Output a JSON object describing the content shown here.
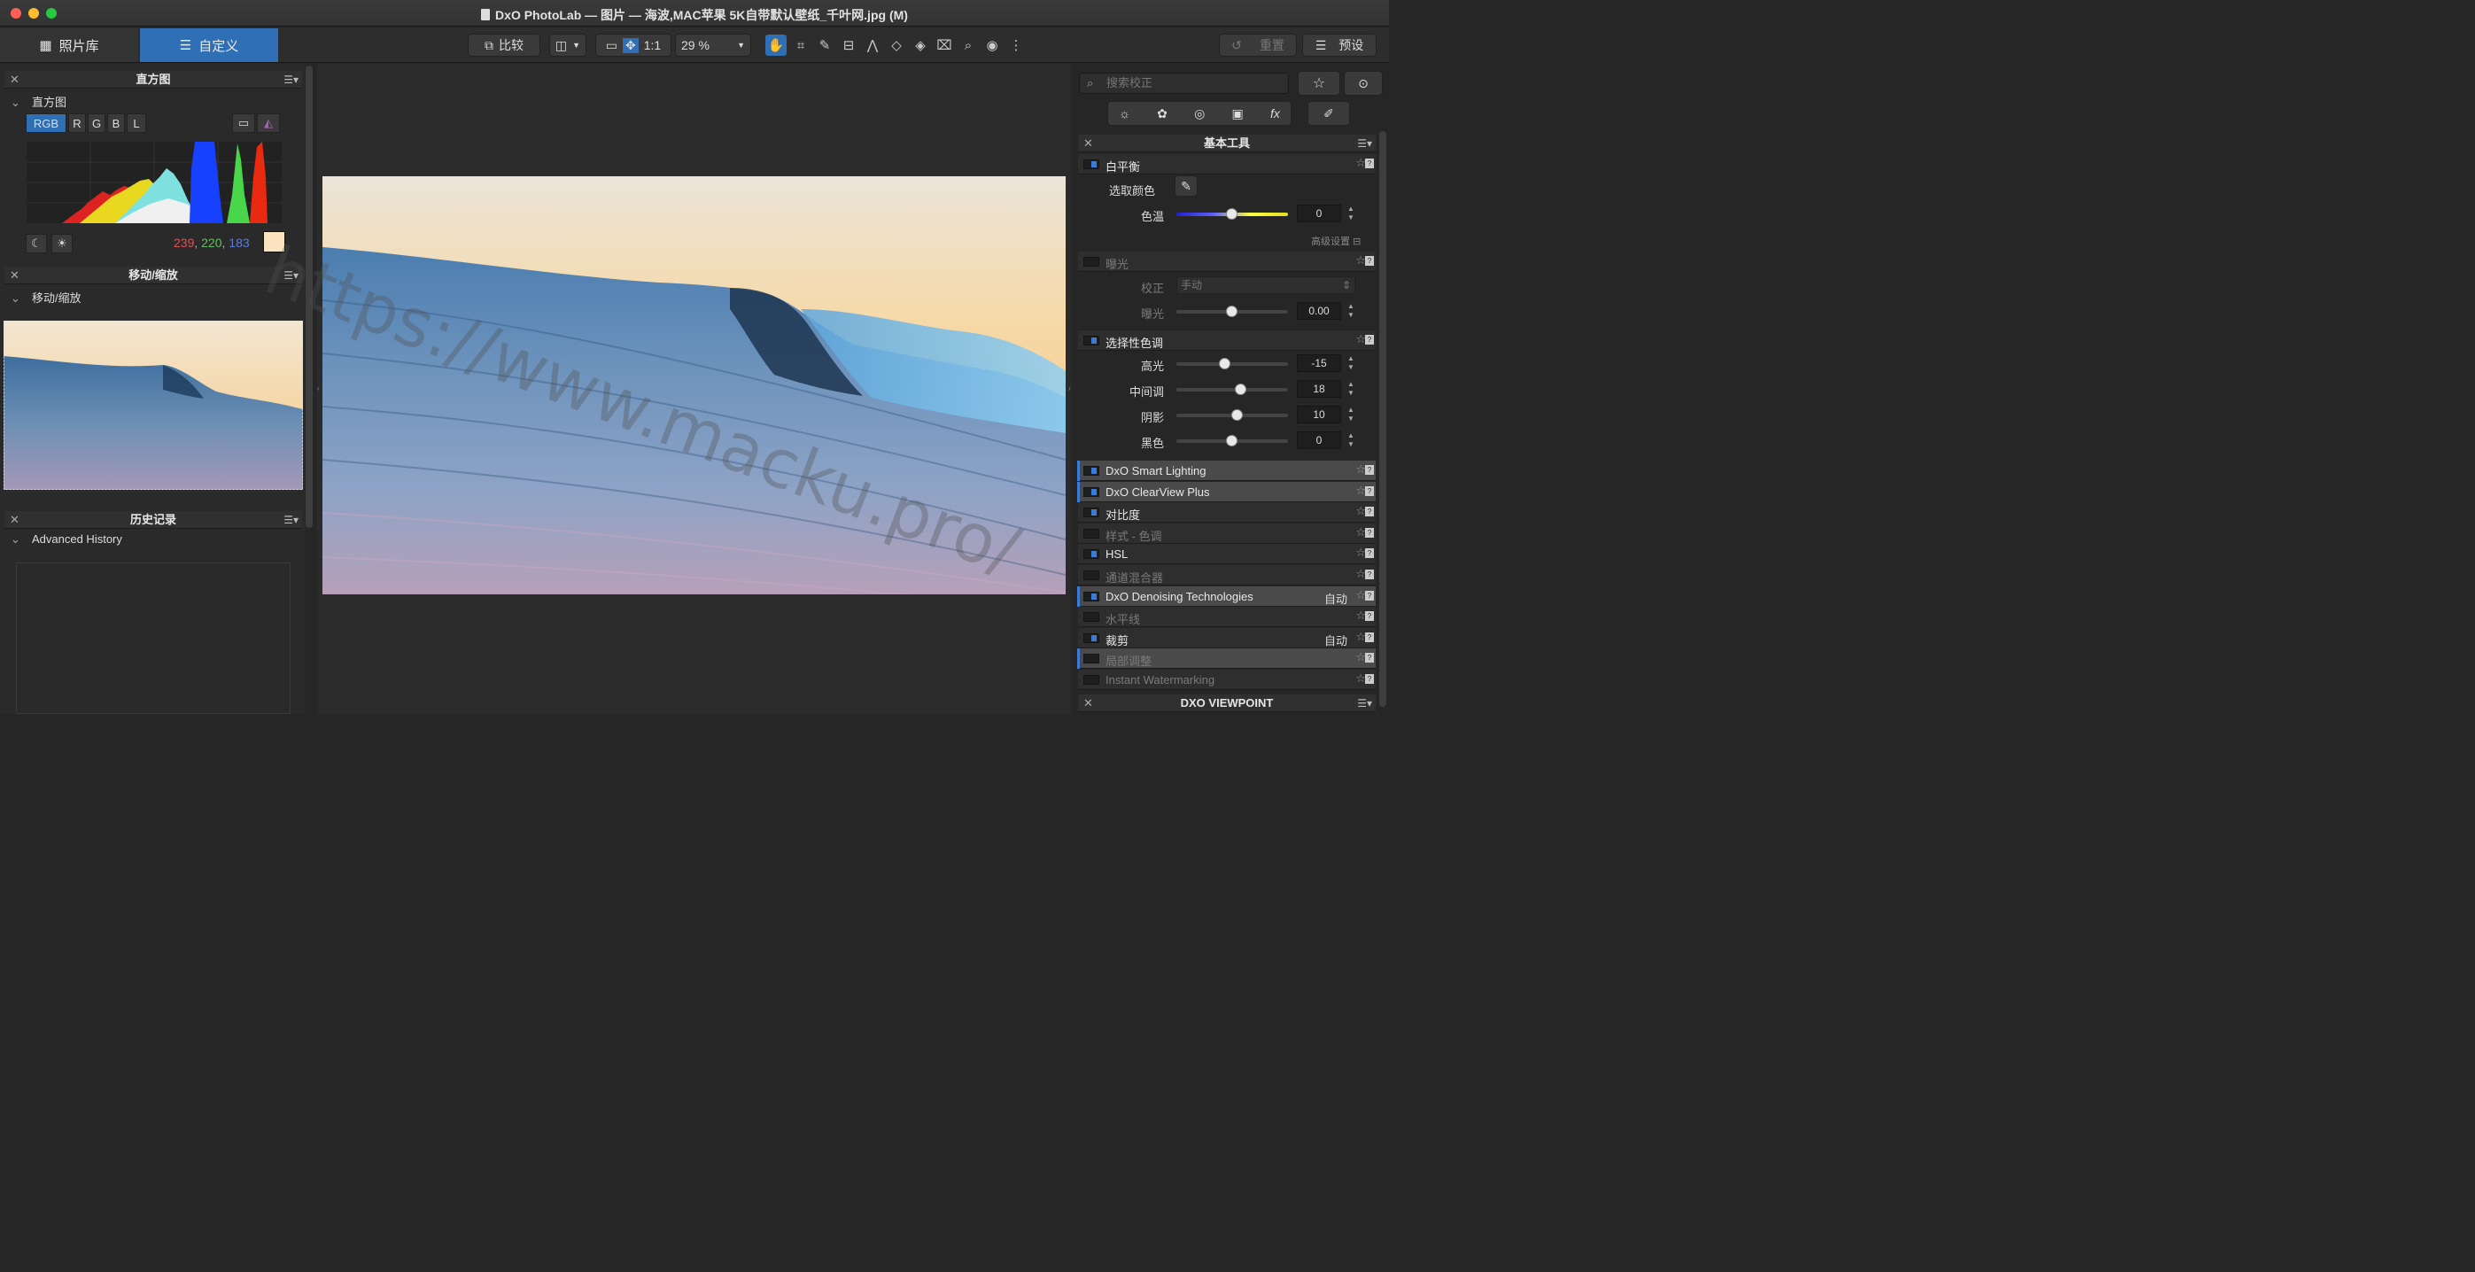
{
  "window": {
    "title": "DxO PhotoLab — 图片 — 海波,MAC苹果 5K自带默认壁纸_千叶网.jpg (M)"
  },
  "toolbar": {
    "library_tab": "照片库",
    "customize_tab": "自定义",
    "compare_label": "比较",
    "one_to_one": "1:1",
    "zoom": "29 %",
    "reset_label": "重置",
    "presets_label": "预设"
  },
  "histogram_panel": {
    "title": "直方图",
    "subtitle": "直方图",
    "channels": [
      "RGB",
      "R",
      "G",
      "B",
      "L"
    ],
    "rgb_r": "239",
    "rgb_g": "220",
    "rgb_b": "183",
    "sep": ",",
    "swatch_color": "#fde4c0"
  },
  "move_zoom_panel": {
    "title": "移动/缩放",
    "subtitle": "移动/缩放"
  },
  "history_panel": {
    "title": "历史记录",
    "subtitle": "Advanced History"
  },
  "right_panel": {
    "search_placeholder": "搜索校正",
    "section_title": "基本工具",
    "white_balance": {
      "name": "白平衡",
      "pick_color": "选取颜色",
      "temp_label": "色温",
      "temp_value": "0",
      "advanced": "高级设置"
    },
    "exposure": {
      "name": "曝光",
      "correction_label": "校正",
      "correction_value": "手动",
      "exposure_label": "曝光",
      "exposure_value": "0.00"
    },
    "selective_tone": {
      "name": "选择性色调",
      "highlights_label": "高光",
      "highlights_value": "-15",
      "midtones_label": "中间调",
      "midtones_value": "18",
      "shadows_label": "阴影",
      "shadows_value": "10",
      "blacks_label": "黑色",
      "blacks_value": "0"
    },
    "tools": [
      {
        "name": "DxO Smart Lighting",
        "auto": ""
      },
      {
        "name": "DxO ClearView Plus",
        "auto": ""
      },
      {
        "name": "对比度",
        "auto": ""
      },
      {
        "name": "样式 - 色调",
        "auto": ""
      },
      {
        "name": "HSL",
        "auto": ""
      },
      {
        "name": "通道混合器",
        "auto": ""
      },
      {
        "name": "DxO Denoising Technologies",
        "auto": "自动"
      },
      {
        "name": "水平线",
        "auto": ""
      },
      {
        "name": "裁剪",
        "auto": "自动"
      },
      {
        "name": "局部调整",
        "auto": ""
      },
      {
        "name": "Instant Watermarking",
        "auto": ""
      }
    ],
    "viewpoint_title": "DXO VIEWPOINT"
  },
  "overlay_watermark": "https://www.macku.pro/",
  "colors": {
    "accent": "#3a7bd5",
    "active_tab": "#2f6fb5"
  }
}
